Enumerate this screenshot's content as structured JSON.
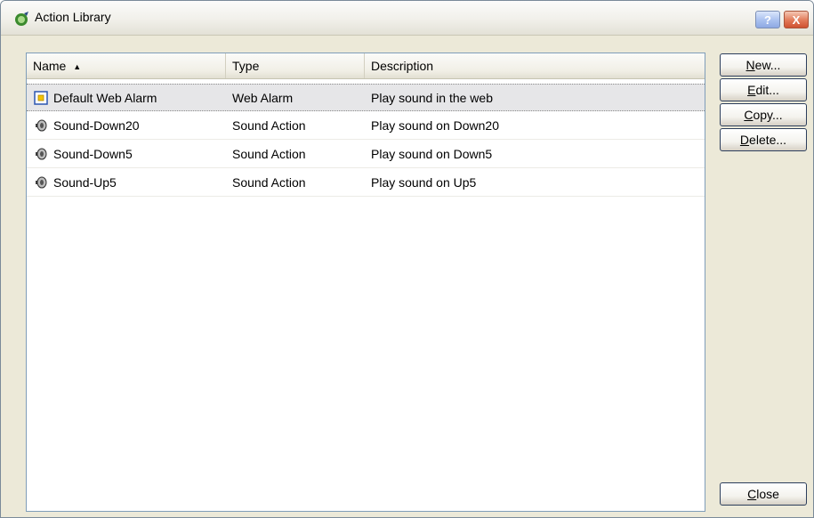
{
  "window": {
    "title": "Action Library",
    "help_label": "?",
    "close_label": "X"
  },
  "list": {
    "columns": [
      "Name",
      "Type",
      "Description"
    ],
    "sort_indicator": "▲",
    "rows": [
      {
        "name": "Default Web Alarm",
        "type": "Web Alarm",
        "description": "Play sound in the web",
        "icon": "web-alarm-icon",
        "selected": true
      },
      {
        "name": "Sound-Down20",
        "type": "Sound Action",
        "description": "Play sound on Down20",
        "icon": "speaker-icon",
        "selected": false
      },
      {
        "name": "Sound-Down5",
        "type": "Sound Action",
        "description": "Play sound on Down5",
        "icon": "speaker-icon",
        "selected": false
      },
      {
        "name": "Sound-Up5",
        "type": "Sound Action",
        "description": "Play sound on Up5",
        "icon": "speaker-icon",
        "selected": false
      }
    ]
  },
  "buttons": {
    "new": {
      "mnemonic": "N",
      "rest": "ew..."
    },
    "edit": {
      "mnemonic": "E",
      "rest": "dit..."
    },
    "copy": {
      "mnemonic": "C",
      "rest": "opy..."
    },
    "delete": {
      "mnemonic": "D",
      "rest": "elete..."
    },
    "close": {
      "mnemonic": "C",
      "rest": "lose"
    }
  },
  "colors": {
    "dialog_bg": "#ece9d8",
    "selection_bg": "#e6e6e8",
    "list_border": "#7f9db9"
  }
}
